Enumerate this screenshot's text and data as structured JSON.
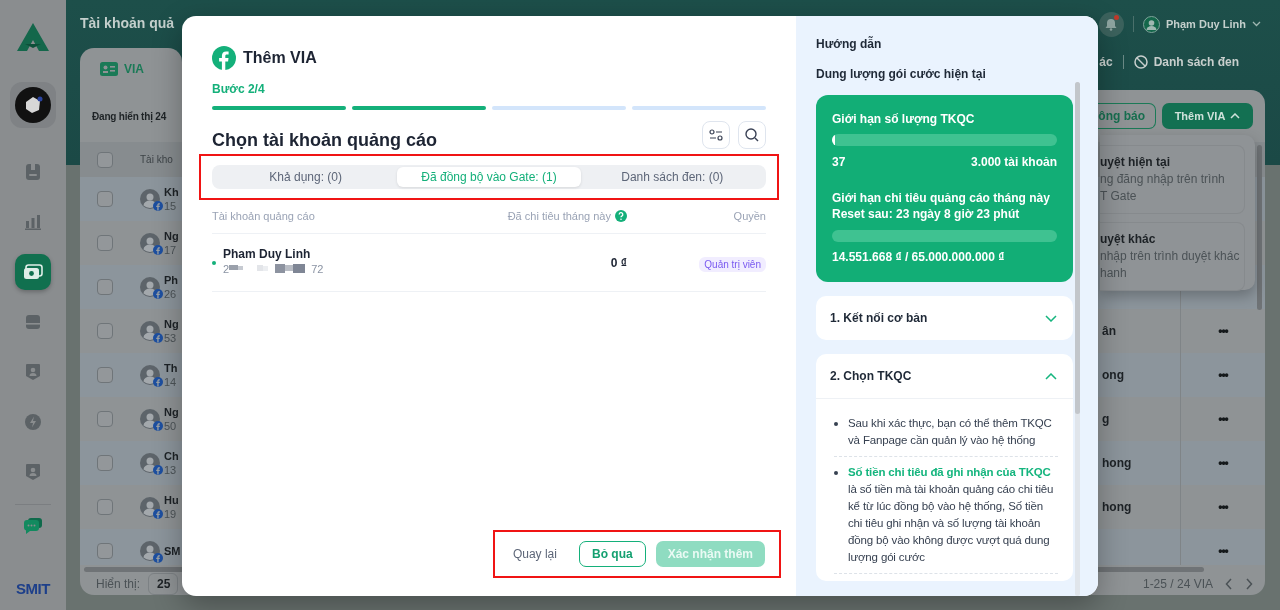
{
  "sidebar": {
    "brand": "SMIT",
    "items": [
      {
        "kind": "document",
        "selected": false
      },
      {
        "kind": "chart",
        "selected": false
      },
      {
        "kind": "wallet",
        "selected": true
      },
      {
        "kind": "card",
        "selected": false
      },
      {
        "kind": "user",
        "selected": false
      },
      {
        "kind": "bolt",
        "selected": false
      },
      {
        "kind": "user",
        "selected": false
      }
    ]
  },
  "header": {
    "title": "Tài khoản quả",
    "has_notification": true,
    "user": "Phạm Duy Linh"
  },
  "page_tabs": [
    {
      "label": "VIA",
      "selected": true
    },
    {
      "label": "ác",
      "selected": false
    },
    {
      "label": "Danh sách đen",
      "selected": false
    }
  ],
  "toolbar": {
    "summary": "Đang hiển thị 24",
    "buttons": [
      {
        "label": "ông báo",
        "kind": "outline"
      },
      {
        "label": "Thêm VIA",
        "kind": "primary",
        "expanded": true
      }
    ]
  },
  "dropdown": {
    "options": [
      {
        "title": "uyệt hiện tại",
        "lines": [
          "ng đăng nhập trên trình",
          "T Gate"
        ]
      },
      {
        "title": "uyệt khác",
        "lines": [
          "nhập trên trình duyệt khác",
          "hanh"
        ]
      }
    ]
  },
  "table": {
    "columns": [
      "Tài kho"
    ],
    "all_checked": false,
    "rows": [
      {
        "name": "Kh",
        "number": "15",
        "checked": false
      },
      {
        "name": "Ng",
        "number": "17",
        "checked": false
      },
      {
        "name": "Ph",
        "number": "26",
        "checked": false
      },
      {
        "name": "Ng",
        "number": "53",
        "column_3": "ân",
        "actions": "•••",
        "checked": false
      },
      {
        "name": "Th",
        "number": "14",
        "column_3": "ong",
        "actions": "•••",
        "checked": false
      },
      {
        "name": "Ng",
        "number": "50",
        "column_3": "g",
        "actions": "•••",
        "checked": false
      },
      {
        "name": "Ch",
        "number": "13",
        "column_3": "hong",
        "actions": "•••",
        "checked": false
      },
      {
        "name": "Hu",
        "number": "19",
        "column_3": "hong",
        "actions": "•••",
        "checked": false
      },
      {
        "name": "SM",
        "actions": "•••",
        "checked": false
      }
    ]
  },
  "pagination": {
    "label": "Hiển thị:",
    "page_size": "25",
    "range": "1-25 / 24 VIA"
  },
  "modal": {
    "title": "Thêm VIA",
    "step": "Bước 2/4",
    "steps": [
      {
        "done": true
      },
      {
        "done": true
      },
      {
        "done": false
      },
      {
        "done": false
      }
    ],
    "heading": "Chọn tài khoản quảng cáo",
    "tabs_highlighted": true,
    "tabs": [
      {
        "label": "Khả dụng: (0)",
        "selected": false
      },
      {
        "label": "Đã đồng bộ vào Gate: (1)",
        "selected": true
      },
      {
        "label": "Danh sách đen: (0)",
        "selected": false
      }
    ],
    "columns": [
      "Tài khoản quảng cáo",
      "Đã chi tiêu tháng này",
      "Quyền"
    ],
    "accounts": [
      {
        "name": "Pham Duy Linh",
        "id_start": "2",
        "id_end": "72",
        "active": true,
        "spent": "0 ₫",
        "role": "Quản trị viên"
      }
    ],
    "actions_highlighted": true,
    "actions": [
      {
        "label": "Quay lại",
        "kind": "text",
        "disabled": false
      },
      {
        "label": "Bỏ qua",
        "kind": "outline",
        "disabled": false
      },
      {
        "label": "Xác nhận thêm",
        "kind": "primary",
        "disabled": true
      }
    ]
  },
  "guide": {
    "title": "Hướng dẫn",
    "subtitle": "Dung lượng gói cước hiện tại",
    "account_limit": {
      "label": "Giới hạn số lượng TKQC",
      "level": 0.0123,
      "used": "37",
      "limit": "3.000 tài khoản"
    },
    "spend_limit": {
      "label": "Giới hạn chi tiêu quảng cáo tháng này",
      "reset": "Reset sau: 23 ngày 8 giờ 23 phút",
      "level": 0.0002,
      "amount": "14.551.668 ₫ / 65.000.000.000 ₫"
    },
    "sections": [
      {
        "title": "1. Kết nối cơ bản",
        "expanded": false
      },
      {
        "title": "2. Chọn TKQC",
        "expanded": true,
        "bullets": [
          "Sau khi xác thực, bạn có thể thêm TKQC và Fanpage cần quản lý vào hệ thống",
          "**Số tiền chi tiêu đã ghi nhận của TKQC** là số tiền mà tài khoản quảng cáo chi tiêu kể từ lúc đồng bộ vào hệ thống, Số tiền chi tiêu ghi nhận và số lượng tài khoản đồng bộ vào không được vượt quá dung lượng gói cước"
        ]
      }
    ]
  }
}
